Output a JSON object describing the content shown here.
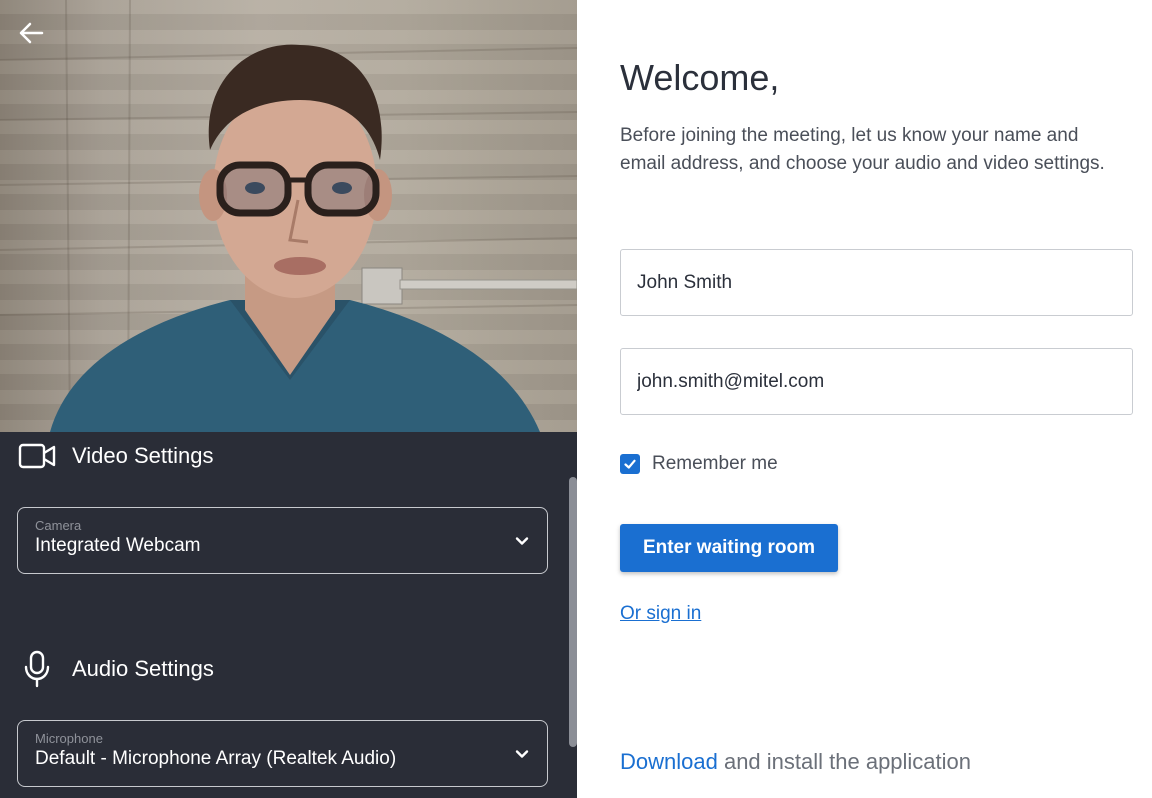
{
  "video_preview": {
    "back_icon": "arrow-left-icon"
  },
  "video_settings": {
    "title": "Video Settings",
    "icon": "video-camera-icon",
    "camera": {
      "label": "Camera",
      "value": "Integrated Webcam"
    }
  },
  "audio_settings": {
    "title": "Audio Settings",
    "icon": "microphone-icon",
    "microphone": {
      "label": "Microphone",
      "value": "Default - Microphone Array (Realtek Audio)"
    }
  },
  "form": {
    "title": "Welcome,",
    "intro": "Before joining the meeting, let us know your name and email address, and choose your audio and video settings.",
    "name_value": "John Smith",
    "email_value": "john.smith@mitel.com",
    "remember_label": "Remember me",
    "remember_checked": true,
    "enter_button": "Enter waiting room",
    "signin_link": "Or sign in",
    "download_link": "Download",
    "download_text": " and install the application"
  },
  "colors": {
    "accent": "#1a6fd1",
    "settings_bg": "#2a2d37",
    "heading": "#2b303b",
    "body_text": "#4a4f59"
  }
}
